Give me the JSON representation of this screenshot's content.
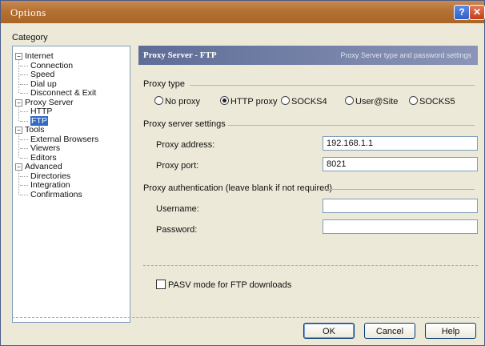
{
  "window": {
    "title": "Options",
    "help_label": "?",
    "close_label": "✕"
  },
  "category_label": "Category",
  "tree": [
    {
      "label": "Internet",
      "level": 0,
      "expander": "⊟"
    },
    {
      "label": "Connection",
      "level": 1
    },
    {
      "label": "Speed",
      "level": 1
    },
    {
      "label": "Dial up",
      "level": 1
    },
    {
      "label": "Disconnect & Exit",
      "level": 1
    },
    {
      "label": "Proxy Server",
      "level": 0,
      "expander": "⊟"
    },
    {
      "label": "HTTP",
      "level": 1
    },
    {
      "label": "FTP",
      "level": 1,
      "selected": true
    },
    {
      "label": "Tools",
      "level": 0,
      "expander": "⊟"
    },
    {
      "label": "External Browsers",
      "level": 1
    },
    {
      "label": "Viewers",
      "level": 1
    },
    {
      "label": "Editors",
      "level": 1
    },
    {
      "label": "Advanced",
      "level": 0,
      "expander": "⊟"
    },
    {
      "label": "Directories",
      "level": 1
    },
    {
      "label": "Integration",
      "level": 1
    },
    {
      "label": "Confirmations",
      "level": 1
    }
  ],
  "banner": {
    "title": "Proxy Server - FTP",
    "subtitle": "Proxy Server type and password settings"
  },
  "proxy_type": {
    "label": "Proxy type",
    "options": [
      {
        "label": "No proxy",
        "checked": false
      },
      {
        "label": "HTTP proxy",
        "checked": true
      },
      {
        "label": "SOCKS4",
        "checked": false
      },
      {
        "label": "User@Site",
        "checked": false
      },
      {
        "label": "SOCKS5",
        "checked": false
      }
    ]
  },
  "proxy_settings": {
    "label": "Proxy server settings",
    "address_label": "Proxy address:",
    "address_value": "192.168.1.1",
    "port_label": "Proxy port:",
    "port_value": "8021"
  },
  "auth": {
    "label": "Proxy authentication (leave blank if not required)",
    "username_label": "Username:",
    "username_value": "",
    "password_label": "Password:",
    "password_value": ""
  },
  "pasv": {
    "label": "PASV mode for FTP downloads",
    "checked": false
  },
  "buttons": {
    "ok": "OK",
    "cancel": "Cancel",
    "help": "Help"
  }
}
